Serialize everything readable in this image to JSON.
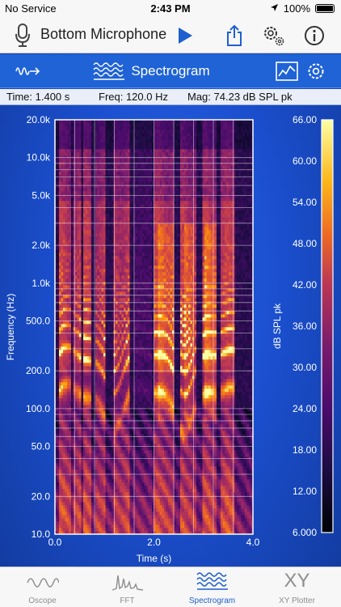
{
  "status": {
    "carrier": "No Service",
    "time": "2:43 PM",
    "battery": "100%"
  },
  "nav": {
    "title": "Bottom Microphone"
  },
  "toolbar": {
    "title": "Spectrogram"
  },
  "readout": {
    "time": "Time: 1.400 s",
    "freq": "Freq: 120.0 Hz",
    "mag": "Mag: 74.23 dB SPL pk"
  },
  "tabs": [
    {
      "label": "Oscope"
    },
    {
      "label": "FFT"
    },
    {
      "label": "Spectrogram"
    },
    {
      "label": "XY Plotter",
      "icon_text": "XY"
    }
  ],
  "colors": {
    "accent": "#1f5fcf",
    "plot_bg": "#0d0718"
  },
  "chart_data": {
    "type": "heatmap",
    "xlabel": "Time (s)",
    "ylabel": "Frequency (Hz)",
    "x_ticks": [
      "0.0",
      "2.0",
      "4.0"
    ],
    "xlim": [
      0,
      4
    ],
    "y_scale": "log",
    "ylim": [
      10,
      20000
    ],
    "y_ticks": [
      {
        "value": 20000,
        "label": "20.0k"
      },
      {
        "value": 10000,
        "label": "10.0k"
      },
      {
        "value": 5000,
        "label": "5.0k"
      },
      {
        "value": 2000,
        "label": "2.0k"
      },
      {
        "value": 1000,
        "label": "1.0k"
      },
      {
        "value": 500,
        "label": "500.0"
      },
      {
        "value": 200,
        "label": "200.0"
      },
      {
        "value": 100,
        "label": "100.0"
      },
      {
        "value": 50,
        "label": "50.0"
      },
      {
        "value": 20,
        "label": "20.0"
      },
      {
        "value": 10,
        "label": "10.0"
      }
    ],
    "colorbar": {
      "label": "dB SPL pk",
      "range": [
        6,
        66
      ],
      "ticks": [
        "66.00",
        "60.00",
        "54.00",
        "48.00",
        "42.00",
        "36.00",
        "30.00",
        "24.00",
        "18.00",
        "12.00",
        "6.000"
      ]
    }
  }
}
